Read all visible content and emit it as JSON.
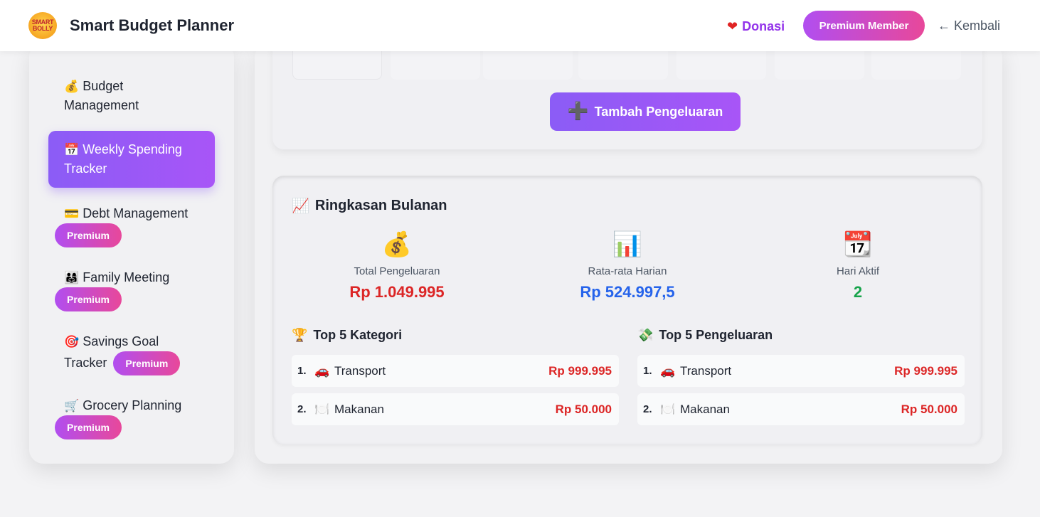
{
  "header": {
    "logo_line1": "SMART",
    "logo_line2": "BOLLY",
    "title": "Smart Budget Planner",
    "donasi_label": "Donasi",
    "premium_label": "Premium Member",
    "kembali_label": "← Kembali"
  },
  "sidebar": {
    "items": [
      {
        "emoji": "💰",
        "label": "Budget Management",
        "badge": ""
      },
      {
        "emoji": "📅",
        "label": "Weekly Spending Tracker",
        "badge": "",
        "active": true
      },
      {
        "emoji": "💳",
        "label": "Debt Management",
        "badge": "Premium"
      },
      {
        "emoji": "👨‍👩‍👧",
        "label": "Family Meeting",
        "badge": "Premium"
      },
      {
        "emoji": "🎯",
        "label": "Savings Goal Tracker",
        "badge": "Premium"
      },
      {
        "emoji": "🛒",
        "label": "Grocery Planning",
        "badge": "Premium"
      }
    ]
  },
  "main": {
    "add_button_label": "Tambah Pengeluaran",
    "summary": {
      "title": "Ringkasan Bulanan",
      "title_icon": "📈",
      "stats": [
        {
          "icon": "💰",
          "label": "Total Pengeluaran",
          "value": "Rp 1.049.995",
          "color": "#dc2626"
        },
        {
          "icon": "📊",
          "label": "Rata-rata Harian",
          "value": "Rp 524.997,5",
          "color": "#2563eb"
        },
        {
          "icon": "📆",
          "label": "Hari Aktif",
          "value": "2",
          "color": "#16a34a"
        }
      ],
      "top_categories": {
        "icon": "🏆",
        "title": "Top 5 Kategori",
        "rows": [
          {
            "rank": "1.",
            "emoji": "🚗",
            "name": "Transport",
            "amount": "Rp 999.995"
          },
          {
            "rank": "2.",
            "emoji": "🍽️",
            "name": "Makanan",
            "amount": "Rp 50.000"
          }
        ]
      },
      "top_expenses": {
        "icon": "💸",
        "title": "Top 5 Pengeluaran",
        "rows": [
          {
            "rank": "1.",
            "emoji": "🚗",
            "name": "Transport",
            "amount": "Rp 999.995"
          },
          {
            "rank": "2.",
            "emoji": "🍽️",
            "name": "Makanan",
            "amount": "Rp 50.000"
          }
        ]
      }
    }
  },
  "colors": {
    "accent_purple": "#8b5cf6",
    "premium_gradient_start": "#b14ef0",
    "premium_gradient_end": "#e8489a",
    "amount_red": "#dc2626"
  }
}
